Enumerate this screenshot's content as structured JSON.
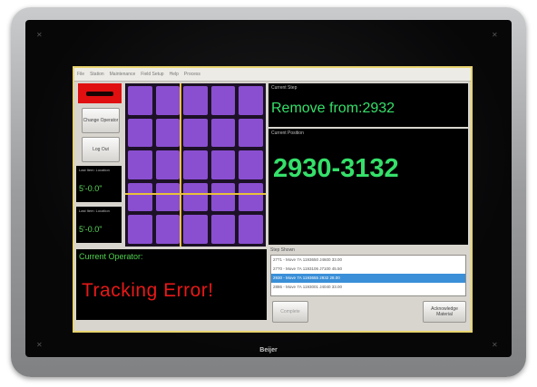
{
  "device": {
    "brand": "Beijer"
  },
  "menubar": {
    "items": [
      "File",
      "Station",
      "Maintenance",
      "Field Setup",
      "Help",
      "Process"
    ]
  },
  "left_panel": {
    "change_operator_label": "Change Operator",
    "log_out_label": "Log Out",
    "bin_boxes": [
      {
        "title": "Last Item: Location",
        "value": "5'-0.0\""
      },
      {
        "title": "Last Item: Location",
        "value": "5'-0.0\""
      }
    ]
  },
  "operator": {
    "label": "Current Operator:",
    "value": "Tracking Error!"
  },
  "current_step": {
    "title": "Current Step",
    "value": "Remove from:2932"
  },
  "current_position": {
    "title": "Current Position",
    "value": "2930-3132"
  },
  "steps": {
    "label": "Step Shown",
    "rows": [
      "2771 - Move  7A  1193650  J4600    33.00",
      "2770 - Move  7A  1193106  J7100    45.50",
      "2930 - Move  7A  1193655  2932     28.00",
      "2886 - Move  7A  1193001  J4040    33.00"
    ],
    "selected_index": 2,
    "left_button_label": "Complete",
    "right_button_label": "Acknowledge Material"
  }
}
